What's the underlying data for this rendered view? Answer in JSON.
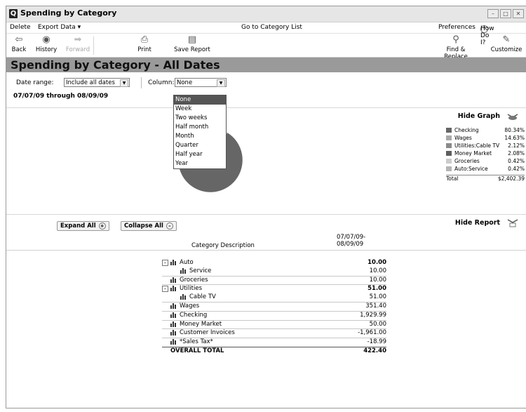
{
  "window": {
    "title": "Spending by Category",
    "app_icon": "Q"
  },
  "menubar": {
    "delete": "Delete",
    "export": "Export Data ▾",
    "goto": "Go to Category List",
    "preferences": "Preferences",
    "howdoi": "How Do I?"
  },
  "toolbar": {
    "back": "Back",
    "history": "History",
    "forward": "Forward",
    "print": "Print",
    "save": "Save Report",
    "find": "Find & Replace",
    "customize": "Customize"
  },
  "page": {
    "heading": "Spending by Category - All Dates"
  },
  "filters": {
    "date_range_label": "Date range:",
    "date_range_value": "Include all dates",
    "column_label": "Column:",
    "column_value": "None",
    "date_text": "07/07/09 through 08/09/09"
  },
  "column_dropdown": {
    "options": [
      "None",
      "Week",
      "Two weeks",
      "Half month",
      "Month",
      "Quarter",
      "Half year",
      "Year"
    ],
    "selected": "None"
  },
  "graph": {
    "hide_label": "Hide Graph",
    "legend": [
      {
        "name": "Checking",
        "value": "80.34%",
        "color": "#666666"
      },
      {
        "name": "Wages",
        "value": "14.63%",
        "color": "#aaaaaa"
      },
      {
        "name": "Utilities:Cable TV",
        "value": "2.12%",
        "color": "#8a8a8a"
      },
      {
        "name": "Money Market",
        "value": "2.08%",
        "color": "#5e5e5e"
      },
      {
        "name": "Groceries",
        "value": "0.42%",
        "color": "#cccccc"
      },
      {
        "name": "Auto:Service",
        "value": "0.42%",
        "color": "#b5b5b5"
      }
    ],
    "total_label": "Total",
    "total_value": "$2,402.39"
  },
  "chart_data": {
    "type": "pie",
    "categories": [
      "Checking",
      "Wages",
      "Utilities:Cable TV",
      "Money Market",
      "Groceries",
      "Auto:Service"
    ],
    "values": [
      80.34,
      14.63,
      2.12,
      2.08,
      0.42,
      0.42
    ],
    "title": "",
    "legend": "right"
  },
  "report": {
    "expand_all": "Expand All",
    "collapse_all": "Collapse All",
    "hide_label": "Hide Report",
    "col_desc": "Category Description",
    "col_period_1": "07/07/09-",
    "col_period_2": "08/09/09",
    "rows": [
      {
        "name": "Auto",
        "amount": "10.00",
        "level": 0,
        "expander": true,
        "bold": true
      },
      {
        "name": "Service",
        "amount": "10.00",
        "level": 1
      },
      {
        "name": "Groceries",
        "amount": "10.00",
        "level": 0,
        "sep": true
      },
      {
        "name": "Utilities",
        "amount": "51.00",
        "level": 0,
        "expander": true,
        "bold": true,
        "sep": true
      },
      {
        "name": "Cable TV",
        "amount": "51.00",
        "level": 1
      },
      {
        "name": "Wages",
        "amount": "351.40",
        "level": 0,
        "sep": true
      },
      {
        "name": "Checking",
        "amount": "1,929.99",
        "level": 0,
        "sep": true
      },
      {
        "name": "Money Market",
        "amount": "50.00",
        "level": 0,
        "sep": true
      },
      {
        "name": "Customer Invoices",
        "amount": "-1,961.00",
        "level": 0,
        "sep": true
      },
      {
        "name": "*Sales Tax*",
        "amount": "-18.99",
        "level": 0,
        "sep": true
      },
      {
        "name": "OVERALL TOTAL",
        "amount": "422.40",
        "level": 0,
        "total": true
      }
    ]
  }
}
